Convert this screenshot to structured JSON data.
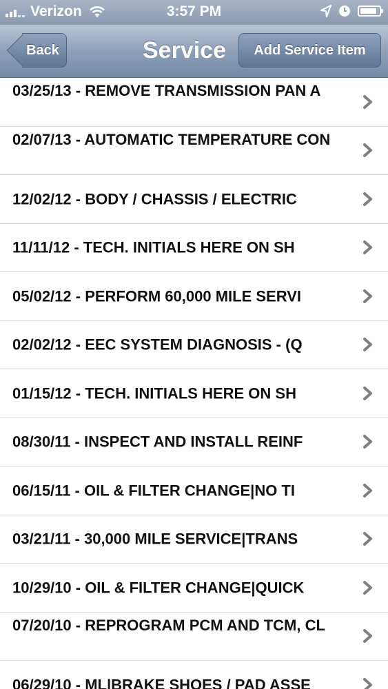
{
  "status_bar": {
    "carrier": "Verizon",
    "time": "3:57 PM",
    "battery_level": 0.9
  },
  "nav": {
    "back_label": "Back",
    "title": "Service",
    "add_label": "Add Service Item"
  },
  "items": [
    {
      "label": "03/25/13 - REMOVE TRANSMISSION PAN A"
    },
    {
      "label": "02/07/13 - AUTOMATIC TEMPERATURE CON"
    },
    {
      "label": "12/02/12 - BODY / CHASSIS / ELECTRIC"
    },
    {
      "label": "11/11/12 - TECH. INITIALS HERE ON SH"
    },
    {
      "label": "05/02/12 - PERFORM 60,000 MILE SERVI"
    },
    {
      "label": "02/02/12 - EEC SYSTEM DIAGNOSIS - (Q"
    },
    {
      "label": "01/15/12 - TECH. INITIALS HERE ON SH"
    },
    {
      "label": "08/30/11 - INSPECT AND INSTALL REINF"
    },
    {
      "label": "06/15/11 - OIL & FILTER CHANGE|NO TI"
    },
    {
      "label": "03/21/11 - 30,000 MILE SERVICE|TRANS"
    },
    {
      "label": "10/29/10 - OIL & FILTER CHANGE|QUICK"
    },
    {
      "label": "07/20/10 - REPROGRAM PCM AND TCM, CL"
    },
    {
      "label": "06/29/10 - ML|BRAKE SHOES / PAD ASSE"
    }
  ],
  "icons": {
    "chevron": "chevron-right-icon",
    "wifi": "wifi-icon",
    "location": "location-arrow-icon",
    "alarm": "clock-icon",
    "battery": "battery-icon"
  },
  "colors": {
    "nav_top": "#b8c4d4",
    "nav_bottom": "#7389a5",
    "chevron": "#7f7f7f"
  }
}
